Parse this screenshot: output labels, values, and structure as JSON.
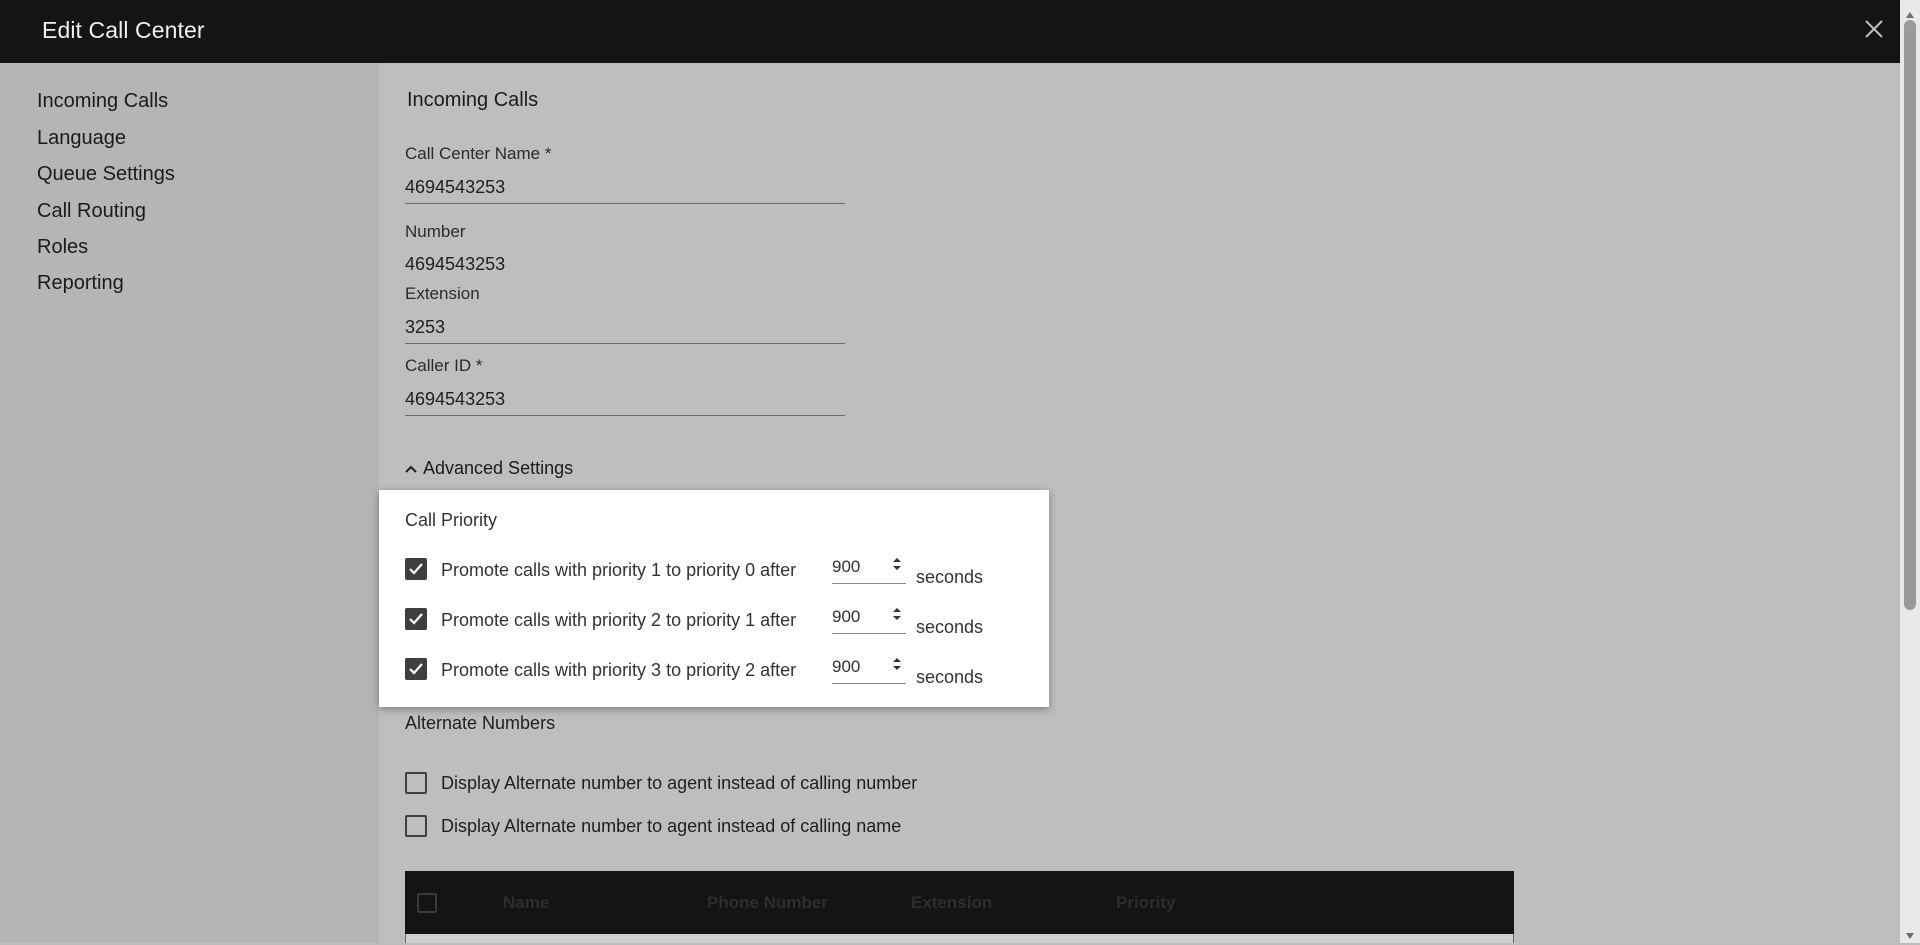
{
  "window": {
    "title": "Edit Call Center"
  },
  "sidebar": {
    "items": [
      {
        "label": "Incoming Calls"
      },
      {
        "label": "Language"
      },
      {
        "label": "Queue Settings"
      },
      {
        "label": "Call Routing"
      },
      {
        "label": "Roles"
      },
      {
        "label": "Reporting"
      }
    ]
  },
  "main": {
    "section_title": "Incoming Calls",
    "fields": {
      "call_center_name": {
        "label": "Call Center Name *",
        "value": "4694543253"
      },
      "number": {
        "label": "Number",
        "value": "4694543253"
      },
      "extension": {
        "label": "Extension",
        "value": "3253"
      },
      "caller_id": {
        "label": "Caller ID *",
        "value": "4694543253"
      }
    },
    "advanced_toggle": "Advanced Settings",
    "call_priority": {
      "title": "Call Priority",
      "rows": [
        {
          "label": "Promote calls with priority 1 to priority 0 after",
          "value": "900",
          "unit": "seconds",
          "checked": true
        },
        {
          "label": "Promote calls with priority 2 to priority 1 after",
          "value": "900",
          "unit": "seconds",
          "checked": true
        },
        {
          "label": "Promote calls with priority 3 to priority 2 after",
          "value": "900",
          "unit": "seconds",
          "checked": true
        }
      ]
    },
    "alternate_numbers": {
      "title": "Alternate Numbers",
      "options": [
        {
          "label": "Display Alternate number to agent instead of calling number",
          "checked": false
        },
        {
          "label": "Display Alternate number to agent instead of calling name",
          "checked": false
        }
      ]
    },
    "table": {
      "columns": [
        "Name",
        "Phone Number",
        "Extension",
        "Priority"
      ]
    }
  },
  "colors": {
    "titlebar_bg": "#141414",
    "overlay_bg": "#bebebe",
    "card_bg": "#ffffff",
    "checkbox": "#3f3f3f"
  }
}
